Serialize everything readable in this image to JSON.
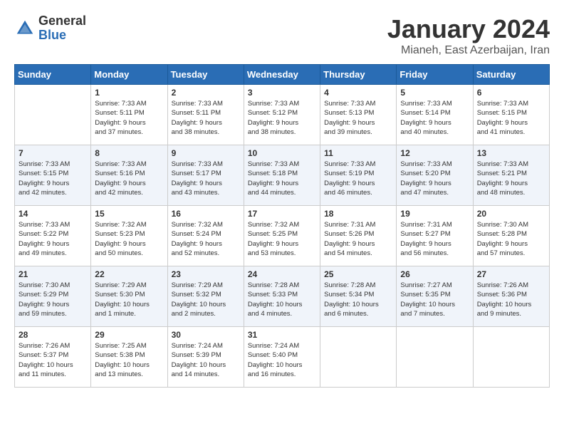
{
  "logo": {
    "general": "General",
    "blue": "Blue"
  },
  "title": "January 2024",
  "subtitle": "Mianeh, East Azerbaijan, Iran",
  "days_of_week": [
    "Sunday",
    "Monday",
    "Tuesday",
    "Wednesday",
    "Thursday",
    "Friday",
    "Saturday"
  ],
  "weeks": [
    [
      {
        "day": "",
        "info": ""
      },
      {
        "day": "1",
        "info": "Sunrise: 7:33 AM\nSunset: 5:11 PM\nDaylight: 9 hours\nand 37 minutes."
      },
      {
        "day": "2",
        "info": "Sunrise: 7:33 AM\nSunset: 5:11 PM\nDaylight: 9 hours\nand 38 minutes."
      },
      {
        "day": "3",
        "info": "Sunrise: 7:33 AM\nSunset: 5:12 PM\nDaylight: 9 hours\nand 38 minutes."
      },
      {
        "day": "4",
        "info": "Sunrise: 7:33 AM\nSunset: 5:13 PM\nDaylight: 9 hours\nand 39 minutes."
      },
      {
        "day": "5",
        "info": "Sunrise: 7:33 AM\nSunset: 5:14 PM\nDaylight: 9 hours\nand 40 minutes."
      },
      {
        "day": "6",
        "info": "Sunrise: 7:33 AM\nSunset: 5:15 PM\nDaylight: 9 hours\nand 41 minutes."
      }
    ],
    [
      {
        "day": "7",
        "info": "Sunrise: 7:33 AM\nSunset: 5:15 PM\nDaylight: 9 hours\nand 42 minutes."
      },
      {
        "day": "8",
        "info": "Sunrise: 7:33 AM\nSunset: 5:16 PM\nDaylight: 9 hours\nand 42 minutes."
      },
      {
        "day": "9",
        "info": "Sunrise: 7:33 AM\nSunset: 5:17 PM\nDaylight: 9 hours\nand 43 minutes."
      },
      {
        "day": "10",
        "info": "Sunrise: 7:33 AM\nSunset: 5:18 PM\nDaylight: 9 hours\nand 44 minutes."
      },
      {
        "day": "11",
        "info": "Sunrise: 7:33 AM\nSunset: 5:19 PM\nDaylight: 9 hours\nand 46 minutes."
      },
      {
        "day": "12",
        "info": "Sunrise: 7:33 AM\nSunset: 5:20 PM\nDaylight: 9 hours\nand 47 minutes."
      },
      {
        "day": "13",
        "info": "Sunrise: 7:33 AM\nSunset: 5:21 PM\nDaylight: 9 hours\nand 48 minutes."
      }
    ],
    [
      {
        "day": "14",
        "info": "Sunrise: 7:33 AM\nSunset: 5:22 PM\nDaylight: 9 hours\nand 49 minutes."
      },
      {
        "day": "15",
        "info": "Sunrise: 7:32 AM\nSunset: 5:23 PM\nDaylight: 9 hours\nand 50 minutes."
      },
      {
        "day": "16",
        "info": "Sunrise: 7:32 AM\nSunset: 5:24 PM\nDaylight: 9 hours\nand 52 minutes."
      },
      {
        "day": "17",
        "info": "Sunrise: 7:32 AM\nSunset: 5:25 PM\nDaylight: 9 hours\nand 53 minutes."
      },
      {
        "day": "18",
        "info": "Sunrise: 7:31 AM\nSunset: 5:26 PM\nDaylight: 9 hours\nand 54 minutes."
      },
      {
        "day": "19",
        "info": "Sunrise: 7:31 AM\nSunset: 5:27 PM\nDaylight: 9 hours\nand 56 minutes."
      },
      {
        "day": "20",
        "info": "Sunrise: 7:30 AM\nSunset: 5:28 PM\nDaylight: 9 hours\nand 57 minutes."
      }
    ],
    [
      {
        "day": "21",
        "info": "Sunrise: 7:30 AM\nSunset: 5:29 PM\nDaylight: 9 hours\nand 59 minutes."
      },
      {
        "day": "22",
        "info": "Sunrise: 7:29 AM\nSunset: 5:30 PM\nDaylight: 10 hours\nand 1 minute."
      },
      {
        "day": "23",
        "info": "Sunrise: 7:29 AM\nSunset: 5:32 PM\nDaylight: 10 hours\nand 2 minutes."
      },
      {
        "day": "24",
        "info": "Sunrise: 7:28 AM\nSunset: 5:33 PM\nDaylight: 10 hours\nand 4 minutes."
      },
      {
        "day": "25",
        "info": "Sunrise: 7:28 AM\nSunset: 5:34 PM\nDaylight: 10 hours\nand 6 minutes."
      },
      {
        "day": "26",
        "info": "Sunrise: 7:27 AM\nSunset: 5:35 PM\nDaylight: 10 hours\nand 7 minutes."
      },
      {
        "day": "27",
        "info": "Sunrise: 7:26 AM\nSunset: 5:36 PM\nDaylight: 10 hours\nand 9 minutes."
      }
    ],
    [
      {
        "day": "28",
        "info": "Sunrise: 7:26 AM\nSunset: 5:37 PM\nDaylight: 10 hours\nand 11 minutes."
      },
      {
        "day": "29",
        "info": "Sunrise: 7:25 AM\nSunset: 5:38 PM\nDaylight: 10 hours\nand 13 minutes."
      },
      {
        "day": "30",
        "info": "Sunrise: 7:24 AM\nSunset: 5:39 PM\nDaylight: 10 hours\nand 14 minutes."
      },
      {
        "day": "31",
        "info": "Sunrise: 7:24 AM\nSunset: 5:40 PM\nDaylight: 10 hours\nand 16 minutes."
      },
      {
        "day": "",
        "info": ""
      },
      {
        "day": "",
        "info": ""
      },
      {
        "day": "",
        "info": ""
      }
    ]
  ]
}
